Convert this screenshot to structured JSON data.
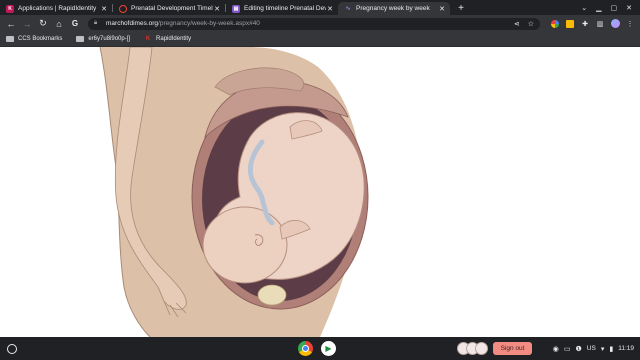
{
  "tabs": [
    {
      "title": "Applications | RapidIdentity",
      "favicon": "rapididentity-icon",
      "active": false
    },
    {
      "title": "Prenatal Development Timeline",
      "favicon": "slides-circle-icon",
      "active": false
    },
    {
      "title": "Editing timeline Prenatal Develo...",
      "favicon": "forms-icon",
      "active": false
    },
    {
      "title": "Pregnancy week by week",
      "favicon": "marchofdimes-icon",
      "active": true
    }
  ],
  "omnibox": {
    "domain": "marchofdimes.org",
    "path": "/pregnancy/week-by-week.aspx#40"
  },
  "bookmarks": [
    {
      "label": "CCS Bookmarks",
      "icon": "folder-icon"
    },
    {
      "label": "er6y7u8i9o0p-[]",
      "icon": "folder-icon"
    },
    {
      "label": "RapidIdentity",
      "icon": "rapididentity-icon"
    }
  ],
  "shelf": {
    "signout_label": "Sign out",
    "locale": "US",
    "time": "11:19"
  },
  "colors": {
    "skin_outer": "#dcc0a8",
    "uterus": "#b08078",
    "baby": "#eed4c6"
  }
}
